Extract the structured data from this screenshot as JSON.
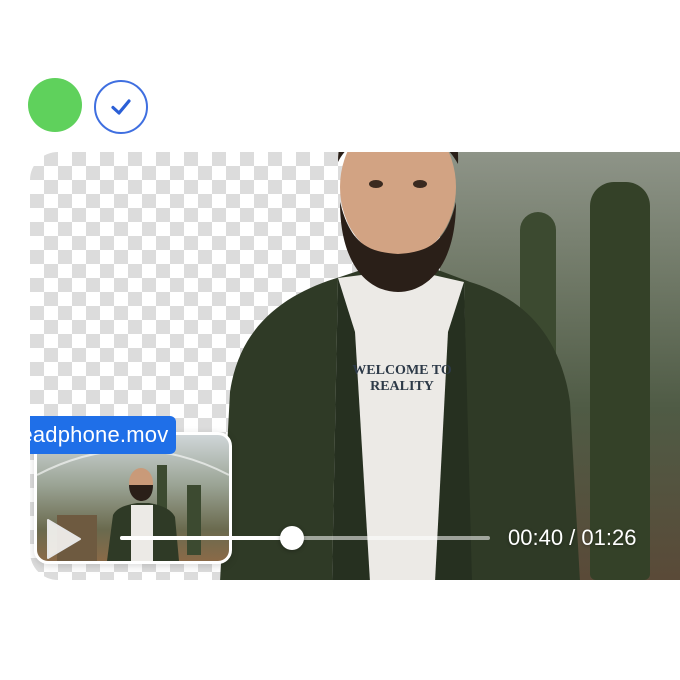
{
  "status": {
    "green_dot": "online-indicator",
    "check_icon": "check-icon"
  },
  "preview": {
    "filename": "headphone.mov"
  },
  "shirt_text": {
    "line1": "WELCOME TO",
    "line2": "REALITY"
  },
  "player": {
    "current_time": "00:40 / 01:26",
    "progress_fraction": 0.465,
    "play_icon": "play-icon"
  },
  "colors": {
    "accent": "#1f6fe8",
    "green": "#5fd15c",
    "check_border": "#3f6fe0"
  }
}
